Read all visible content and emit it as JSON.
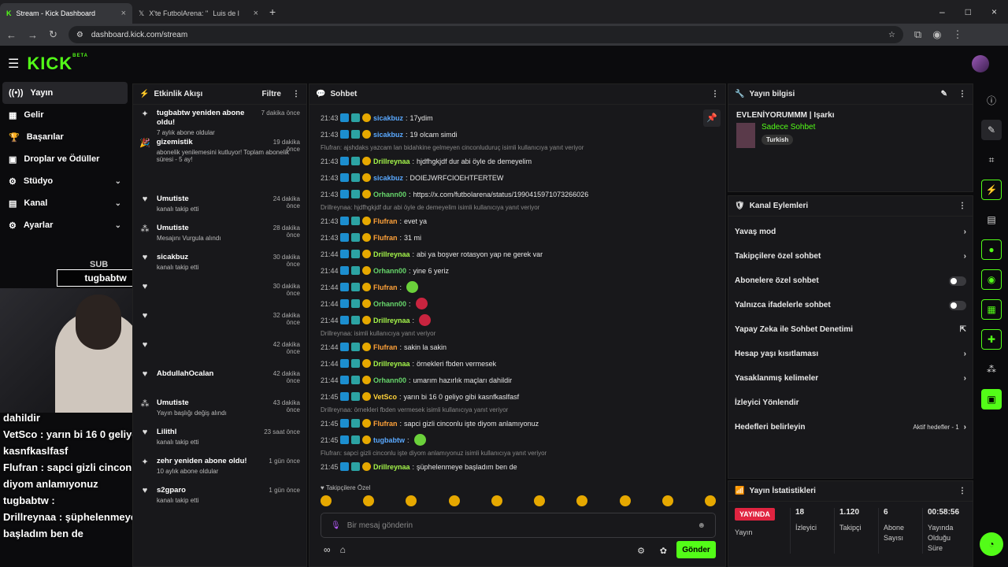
{
  "browser": {
    "tabs": [
      {
        "title": "Stream - Kick Dashboard",
        "active": true
      },
      {
        "title": "X'te FutbolArena: \"",
        "active": false
      },
      {
        "title": "Luis de l",
        "active": false
      }
    ],
    "url": "dashboard.kick.com/stream"
  },
  "brand": {
    "logo": "KICK",
    "beta": "BETA",
    "accent": "#53fc18"
  },
  "sidebar": [
    {
      "label": "Yayın",
      "icon": "broadcast-icon",
      "active": true
    },
    {
      "label": "Gelir",
      "icon": "wallet-icon"
    },
    {
      "label": "Başarılar",
      "icon": "trophy-icon"
    },
    {
      "label": "Droplar ve Ödüller",
      "icon": "gift-icon"
    },
    {
      "label": "Stüdyo",
      "icon": "studio-icon",
      "chev": true
    },
    {
      "label": "Kanal",
      "icon": "channel-icon",
      "chev": true
    },
    {
      "label": "Ayarlar",
      "icon": "gear-icon",
      "chev": true
    }
  ],
  "activity": {
    "title": "Etkinlik Akışı",
    "filter": "Filtre",
    "items": [
      {
        "t": "tugbabtw yeniden abone oldu!",
        "s": "7 aylık abone oldular",
        "tm": "7 dakika önce",
        "icon": "star-icon"
      },
      {
        "t": "gizemistik",
        "s": "abonelik yenilemesini kutluyor! Toplam abonelik süresi - 5 ay!",
        "tm": "19 dakika önce",
        "icon": "celebrate-icon"
      },
      {
        "t": "Umutiste",
        "s": "kanalı takip etti",
        "tm": "24 dakika önce",
        "icon": "heart-icon"
      },
      {
        "t": "Umutiste",
        "s": "Mesajını Vurgula alındı",
        "tm": "28 dakika önce",
        "icon": "redeem-icon"
      },
      {
        "t": "sicakbuz",
        "s": "kanalı takip etti",
        "tm": "30 dakika önce",
        "icon": "heart-icon"
      },
      {
        "t": "",
        "s": "",
        "tm": "30 dakika önce",
        "icon": "heart-icon"
      },
      {
        "t": "",
        "s": "",
        "tm": "32 dakika önce",
        "icon": "heart-icon"
      },
      {
        "t": "",
        "s": "",
        "tm": "42 dakika önce",
        "icon": "heart-icon"
      },
      {
        "t": "AbdullahOcalan",
        "s": "",
        "tm": "42 dakika önce",
        "icon": "heart-icon"
      },
      {
        "t": "Umutiste",
        "s": "Yayın başlığı değiş alındı",
        "tm": "43 dakika önce",
        "icon": "redeem-icon"
      },
      {
        "t": "Lilithl",
        "s": "kanalı takip etti",
        "tm": "23 saat önce",
        "icon": "heart-icon"
      },
      {
        "t": "zehr yeniden abone oldu!",
        "s": "10 aylık abone oldular",
        "tm": "1 gün önce",
        "icon": "star-icon"
      },
      {
        "t": "s2gparo",
        "s": "kanalı takip etti",
        "tm": "1 gün önce",
        "icon": "heart-icon"
      }
    ]
  },
  "chat": {
    "title": "Sohbet",
    "input_placeholder": "Bir mesaj gönderin",
    "send": "Gönder",
    "followers_only": "Takipçilere Özel",
    "messages": [
      {
        "ts": "21:43",
        "u": "sicakbuz",
        "c": "#5aa9ff",
        "tx": "17ydim"
      },
      {
        "ts": "21:43",
        "u": "sicakbuz",
        "c": "#5aa9ff",
        "tx": "19 olcam simdi"
      },
      {
        "reply": "Flufran: ajshdaks yazcam lan bidahkine gelmeyen cinconluduruç isimli kullanıcıya yanıt veriyor"
      },
      {
        "ts": "21:43",
        "u": "Drillreynaa",
        "c": "#a4f54a",
        "tx": "hjdfhgkjdf dur abi öyle de demeyelim"
      },
      {
        "ts": "21:43",
        "u": "sicakbuz",
        "c": "#5aa9ff",
        "tx": "DOIEJWRFCIOEHTFERTEW"
      },
      {
        "ts": "21:43",
        "u": "Orhann00",
        "c": "#67d66b",
        "tx": "https://x.com/futbolarena/status/1990415971073266026"
      },
      {
        "reply": "Drillreynaa: hjdfhgkjdf dur abi öyle de demeyelim isimli kullanıcıya yanıt veriyor"
      },
      {
        "ts": "21:43",
        "u": "Flufran",
        "c": "#ffa23a",
        "tx": "evet ya"
      },
      {
        "ts": "21:43",
        "u": "Flufran",
        "c": "#ffa23a",
        "tx": "31 mi"
      },
      {
        "ts": "21:44",
        "u": "Drillreynaa",
        "c": "#a4f54a",
        "tx": "abi ya boşver rotasyon yap ne gerek var"
      },
      {
        "ts": "21:44",
        "u": "Orhann00",
        "c": "#67d66b",
        "tx": "yine 6 yeriz"
      },
      {
        "ts": "21:44",
        "u": "Flufran",
        "c": "#ffa23a",
        "tx": ""
      },
      {
        "ts": "21:44",
        "u": "Orhann00",
        "c": "#67d66b",
        "tx": ""
      },
      {
        "ts": "21:44",
        "u": "Drillreynaa",
        "c": "#a4f54a",
        "tx": ""
      },
      {
        "reply": "Drillreynaa: isimli kullanıcıya yanıt veriyor"
      },
      {
        "ts": "21:44",
        "u": "Flufran",
        "c": "#ffa23a",
        "tx": "sakin la sakin"
      },
      {
        "ts": "21:44",
        "u": "Drillreynaa",
        "c": "#a4f54a",
        "tx": "örnekleri fbden vermesek"
      },
      {
        "ts": "21:44",
        "u": "Orhann00",
        "c": "#67d66b",
        "tx": "umarım hazırlık maçları dahildir"
      },
      {
        "ts": "21:45",
        "u": "VetSco",
        "c": "#ffd23a",
        "tx": "yarın bi 16 0 geliyo gibi kasnfkaslfasf"
      },
      {
        "reply": "Drillreynaa: örnekleri fbden vermesek isimli kullanıcıya yanıt veriyor"
      },
      {
        "ts": "21:45",
        "u": "Flufran",
        "c": "#ffa23a",
        "tx": "sapci gizli cinconlu işte diyom anlamıyonuz"
      },
      {
        "ts": "21:45",
        "u": "tugbabtw",
        "c": "#5aa9ff",
        "tx": ""
      },
      {
        "reply": "Flufran: sapci gizli cinconlu işte diyom anlamıyonuz isimli kullanıcıya yanıt veriyor"
      },
      {
        "ts": "21:45",
        "u": "Drillreynaa",
        "c": "#a4f54a",
        "tx": "şüphelenmeye başladım ben de"
      }
    ]
  },
  "info": {
    "title": "Yayın bilgisi",
    "stream_title": "EVLENİYORUMMM | Işarkı",
    "category": "Sadece Sohbet",
    "language": "Turkish"
  },
  "actions": {
    "title": "Kanal Eylemleri",
    "rows": [
      {
        "l": "Yavaş mod",
        "k": "chev"
      },
      {
        "l": "Takipçilere özel sohbet",
        "k": "chev"
      },
      {
        "l": "Abonelere özel sohbet",
        "k": "toggle"
      },
      {
        "l": "Yalnızca ifadelerle sohbet",
        "k": "toggle"
      },
      {
        "l": "Yapay Zeka ile Sohbet Denetimi",
        "k": "ext"
      },
      {
        "l": "Hesap yaşı kısıtlaması",
        "k": "chev"
      },
      {
        "l": "Yasaklanmış kelimeler",
        "k": "chev"
      },
      {
        "l": "İzleyici Yönlendir",
        "k": "none"
      },
      {
        "l": "Hedefleri belirleyin",
        "k": "goal",
        "extra": "Aktif hedefler - 1"
      }
    ]
  },
  "stats": {
    "title": "Yayın İstatistikleri",
    "live": "YAYINDA",
    "live_label": "Yayın",
    "cols": [
      {
        "v": "18",
        "l": "İzleyici"
      },
      {
        "v": "1.120",
        "l": "Takipçi"
      },
      {
        "v": "6",
        "l": "Abone Sayısı"
      },
      {
        "v": "00:58:56",
        "l": "Yayında Olduğu Süre"
      }
    ]
  },
  "overlay": {
    "sub_label": "SUB",
    "sub_user": "tugbabtw",
    "lines": [
      "dahildir",
      "VetSco : yarın bi 16 0 geliyo gibi",
      "kasnfkaslfasf",
      "Flufran : sapci gizli cinconlu işte",
      "diyom anlamıyonuz",
      "tugbabtw :",
      "Drillreynaa : şüphelenmeye",
      "başladım ben de"
    ]
  }
}
